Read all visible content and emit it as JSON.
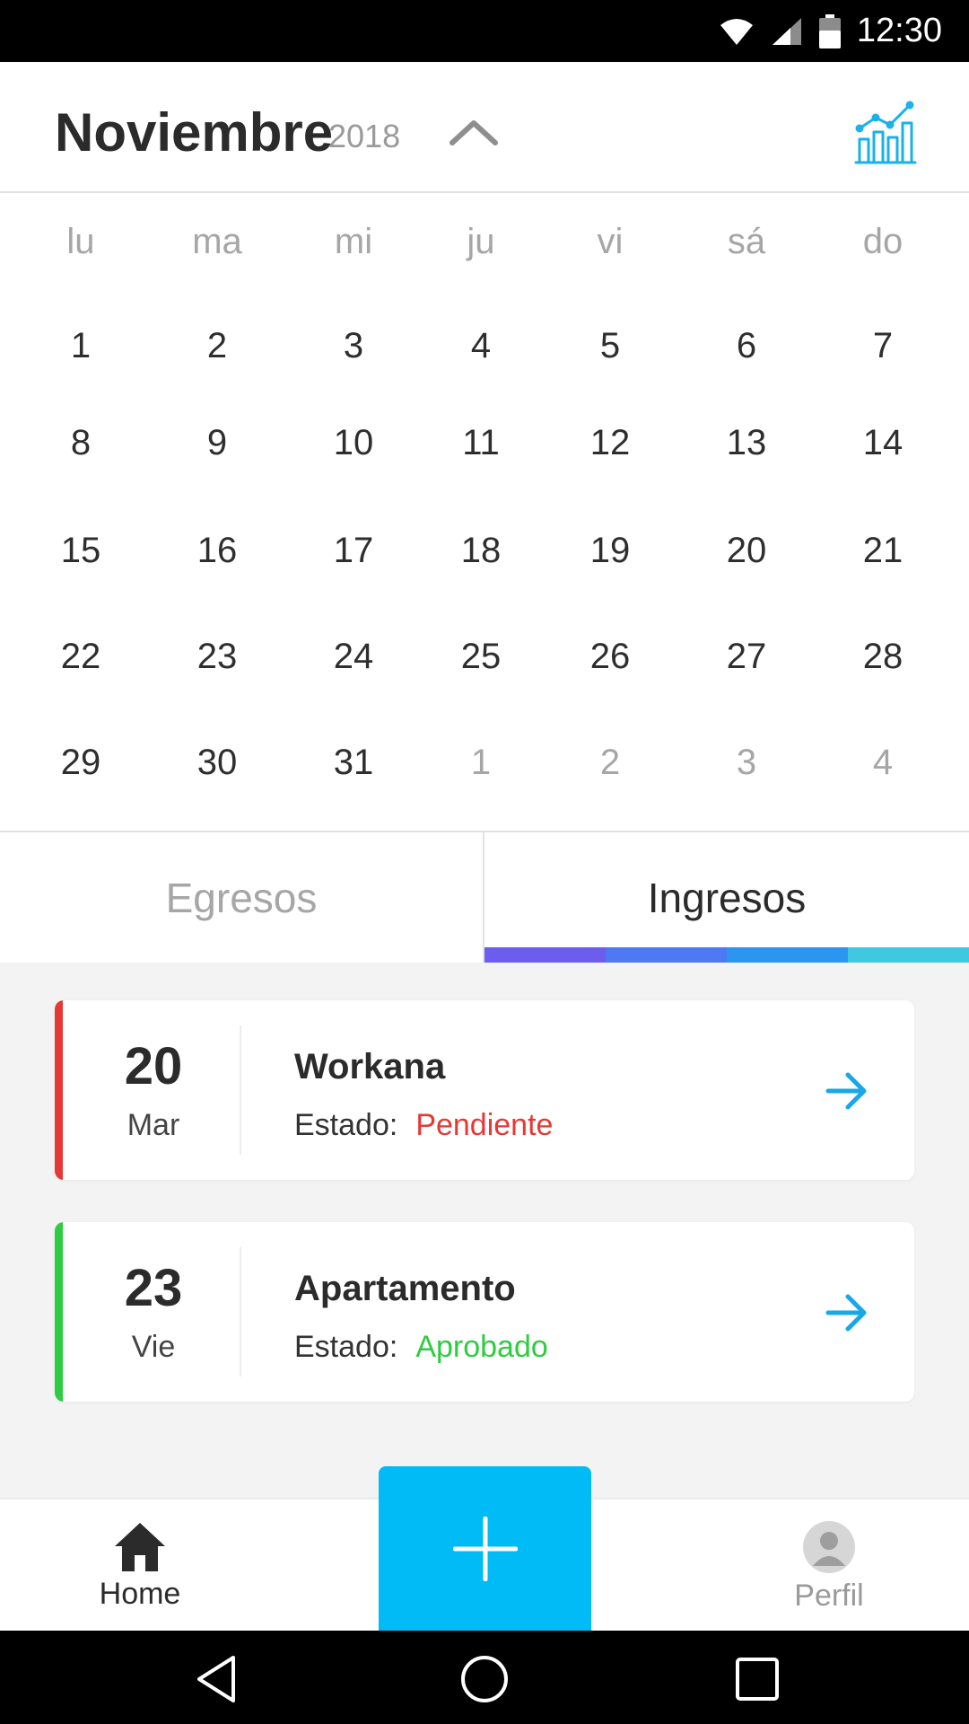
{
  "status_bar": {
    "time": "12:30"
  },
  "header": {
    "month": "Noviembre",
    "year": "2018"
  },
  "calendar": {
    "weekdays": [
      "lu",
      "ma",
      "mi",
      "ju",
      "vi",
      "sá",
      "do"
    ],
    "weeks": [
      [
        "1",
        "2",
        "3",
        "4",
        "5",
        "6",
        "7"
      ],
      [
        "8",
        "9",
        "10",
        "11",
        "12",
        "13",
        "14"
      ],
      [
        "15",
        "16",
        "17",
        "18",
        "19",
        "20",
        "21"
      ],
      [
        "22",
        "23",
        "24",
        "25",
        "26",
        "27",
        "28"
      ],
      [
        "29",
        "30",
        "31",
        "1",
        "2",
        "3",
        "4"
      ]
    ],
    "next_month_days_in_last_week": 4
  },
  "tabs": {
    "egresos": "Egresos",
    "ingresos": "Ingresos",
    "active": "ingresos",
    "indicator_colors": [
      "#6c5cf0",
      "#4f78f5",
      "#2b95f0",
      "#3ec9e0"
    ]
  },
  "transactions": [
    {
      "day": "20",
      "weekday": "Mar",
      "title": "Workana",
      "status_label": "Estado:",
      "status": "Pendiente",
      "status_color": "#e53935",
      "stripe_color": "#e53935"
    },
    {
      "day": "23",
      "weekday": "Vie",
      "title": "Apartamento",
      "status_label": "Estado:",
      "status": "Aprobado",
      "status_color": "#2ecc40",
      "stripe_color": "#2ecc40"
    }
  ],
  "bottom_nav": {
    "home": "Home",
    "profile": "Perfil"
  },
  "colors": {
    "accent": "#00bbf5",
    "arrow": "#1aa7e8"
  },
  "icons": [
    "wifi-icon",
    "signal-icon",
    "battery-icon",
    "chevron-up-icon",
    "stats-chart-icon",
    "arrow-right-icon",
    "home-icon",
    "plus-icon",
    "avatar-icon",
    "back-icon",
    "home-circle-icon",
    "recents-icon"
  ]
}
